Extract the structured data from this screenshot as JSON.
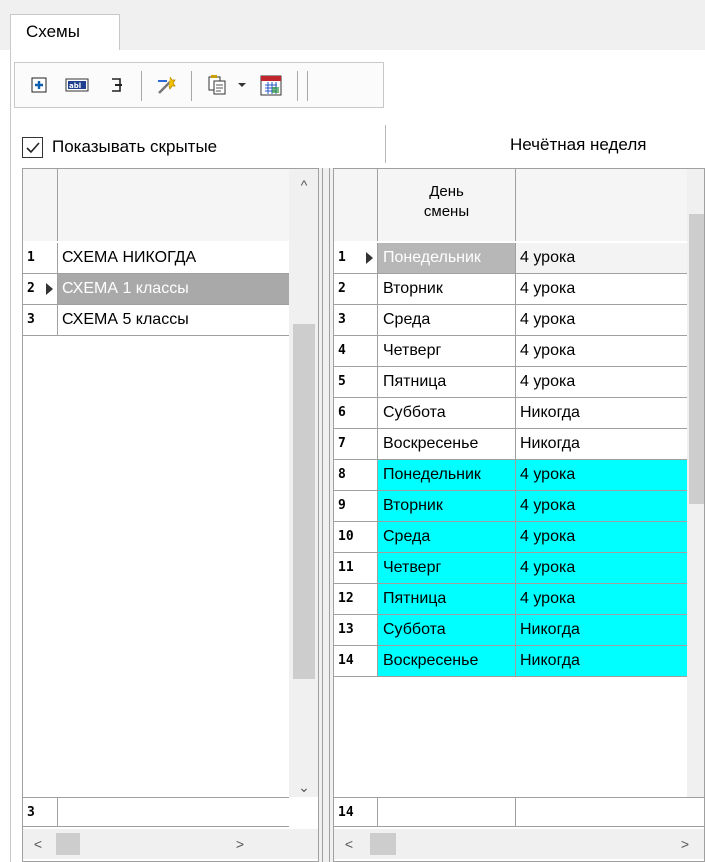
{
  "tabs": [
    {
      "label": "Схемы",
      "active": true
    }
  ],
  "toolbar": {
    "buttons": [
      {
        "name": "add-row-icon"
      },
      {
        "name": "rename-field-icon"
      },
      {
        "name": "delete-row-icon"
      },
      {
        "name": "edit-wand-icon"
      },
      {
        "name": "copy-icon"
      },
      {
        "name": "dropdown-arrow-icon"
      },
      {
        "name": "calendar-icon"
      }
    ]
  },
  "show_hidden": {
    "label": "Показывать скрытые",
    "checked": true
  },
  "week_label": "Нечётная неделя",
  "schemes": {
    "rows": [
      {
        "num": "1",
        "name": " СХЕМА НИКОГДА"
      },
      {
        "num": "2",
        "name": "СХЕМА 1 классы"
      },
      {
        "num": "3",
        "name": "СХЕМА 5 классы"
      }
    ],
    "footer_count": "3"
  },
  "days": {
    "header": {
      "day": "День\nсмены",
      "value": ""
    },
    "rows": [
      {
        "num": "1",
        "day": "Понедельник",
        "value": "4 урока"
      },
      {
        "num": "2",
        "day": "Вторник",
        "value": "4 урока"
      },
      {
        "num": "3",
        "day": "Среда",
        "value": "4 урока"
      },
      {
        "num": "4",
        "day": "Четверг",
        "value": "4 урока"
      },
      {
        "num": "5",
        "day": "Пятница",
        "value": "4 урока"
      },
      {
        "num": "6",
        "day": "Суббота",
        "value": " Никогда"
      },
      {
        "num": "7",
        "day": "Воскресенье",
        "value": "Никогда"
      },
      {
        "num": "8",
        "day": "Понедельник",
        "value": "4 урока"
      },
      {
        "num": "9",
        "day": "Вторник",
        "value": "4 урока"
      },
      {
        "num": "10",
        "day": "Среда",
        "value": "4 урока"
      },
      {
        "num": "11",
        "day": "Четверг",
        "value": "4 урока"
      },
      {
        "num": "12",
        "day": "Пятница",
        "value": "4 урока"
      },
      {
        "num": "13",
        "day": "Суббота",
        "value": " Никогда"
      },
      {
        "num": "14",
        "day": "Воскресенье",
        "value": "Никогда"
      }
    ],
    "footer_count": "14"
  },
  "colors": {
    "highlight": "#00ffff",
    "selected": "#a9a9a9"
  }
}
